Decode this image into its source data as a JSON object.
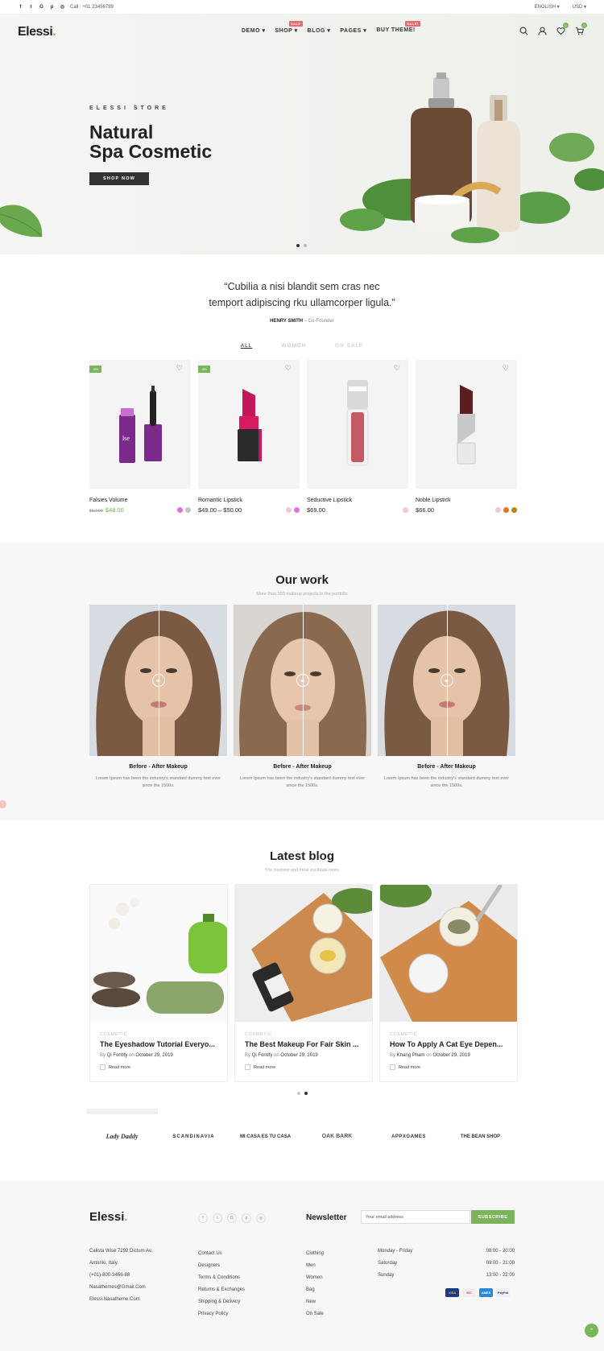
{
  "topbar": {
    "call": "Call : +01 23456789",
    "language": "ENGLISH",
    "currency": "USD"
  },
  "header": {
    "logo": "Elessi",
    "nav": [
      {
        "label": "DEMO",
        "badge": ""
      },
      {
        "label": "SHOP",
        "badge": "SALE"
      },
      {
        "label": "BLOG",
        "badge": ""
      },
      {
        "label": "PAGES",
        "badge": ""
      },
      {
        "label": "BUY THEME!",
        "badge": "SALE!"
      }
    ],
    "wishlist_count": "0",
    "cart_count": "0"
  },
  "hero": {
    "subtitle": "ELESSI STORE",
    "title_line1": "Natural",
    "title_line2": "Spa Cosmetic",
    "button": "SHOP NOW"
  },
  "quote": {
    "line1": "“Cubilia a nisi blandit sem cras nec",
    "line2": "temport adipiscing rku ullamcorper ligula.”",
    "author": "HENRY SMITH",
    "role": "– Co-Founder"
  },
  "tabs": [
    "ALL",
    "WOMEN",
    "ON SALE"
  ],
  "products": [
    {
      "name": "Falsies Volume",
      "old_price": "$52.00",
      "price": "$48.00",
      "badge": "-8%",
      "swatches": [
        "#e26ee8",
        "#c4c4c4"
      ]
    },
    {
      "name": "Romantic Lipstick",
      "old_price": "",
      "price": "$49.00 – $50.00",
      "badge": "-8%",
      "swatches": [
        "#f5c6d4",
        "#e26ee8"
      ]
    },
    {
      "name": "Seductive Lipstick",
      "old_price": "",
      "price": "$69.00",
      "badge": "",
      "swatches": [
        "#f5c6d4"
      ]
    },
    {
      "name": "Noble Lipstick",
      "old_price": "",
      "price": "$66.00",
      "badge": "",
      "swatches": [
        "#f5c6d4",
        "#e8731a",
        "#b8860b"
      ]
    }
  ],
  "work": {
    "title": "Our work",
    "subtitle": "More than 300 makeup projects in the portfolio",
    "items": [
      {
        "title": "Before - After Makeup",
        "desc": "Lorem Ipsum has been the industry's standard dummy text ever since the 1500s."
      },
      {
        "title": "Before - After Makeup",
        "desc": "Lorem Ipsum has been the industry's standard dummy text ever since the 1500s."
      },
      {
        "title": "Before - After Makeup",
        "desc": "Lorem Ipsum has been the industry's standard dummy text ever since the 1500s."
      }
    ]
  },
  "blog": {
    "title": "Latest blog",
    "subtitle": "The freshest and most excitings news",
    "posts": [
      {
        "category": "COSMETIC",
        "title": "The Eyeshadow Tutorial Everyo...",
        "by": "By",
        "author": "Qi Fontify",
        "on": "on",
        "date": "October 29, 2019",
        "more": "Read more"
      },
      {
        "category": "COSMETIC",
        "title": "The Best Makeup For Fair Skin ...",
        "by": "By",
        "author": "Qi Fontify",
        "on": "on",
        "date": "October 29, 2019",
        "more": "Read more"
      },
      {
        "category": "COSMETIC",
        "title": "How To Apply A Cat Eye Depen...",
        "by": "By",
        "author": "Khang Pham",
        "on": "on",
        "date": "October 29, 2019",
        "more": "Read more"
      }
    ]
  },
  "brands": [
    "Lady Daddy",
    "SCANDINAVIA",
    "MI CASA ES TU CASA",
    "OAK BARK",
    "APPXGAMES",
    "THE BEAN SHOP"
  ],
  "footer": {
    "logo": "Elessi",
    "newsletter_title": "Newsletter",
    "newsletter_placeholder": "Your email address",
    "subscribe": "SUBSCRIBE",
    "contact": [
      "Calista Wise 7292 Dictum Av.",
      "Antonio, Italy.",
      "(+01)-800-3456-88",
      "Nasathemes@Gmail.Com",
      "Elessi.Nasatheme.Com"
    ],
    "links1": [
      "Contact Us",
      "Designers",
      "Terms & Conditions",
      "Returns & Exchanges",
      "Shipping & Delivery",
      "Privacy Policy"
    ],
    "links2": [
      "Clothing",
      "Men",
      "Women",
      "Bag",
      "New",
      "On Sale"
    ],
    "hours": [
      {
        "day": "Monday - Friday",
        "time": "08:00 - 20:00"
      },
      {
        "day": "Saturday",
        "time": "09:00 - 21:00"
      },
      {
        "day": "Sunday",
        "time": "13:00 - 22:00"
      }
    ],
    "payments": [
      "VISA",
      "MC",
      "AMEX",
      "PayPal"
    ]
  }
}
